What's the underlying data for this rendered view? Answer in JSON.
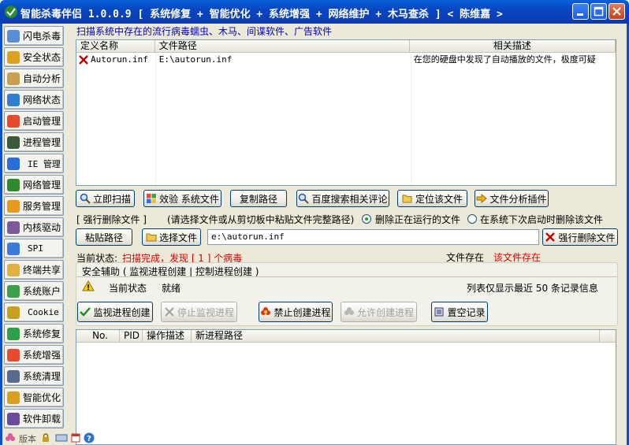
{
  "window": {
    "title": "智能杀毒伴侣 1.0.0.9 [ 系统修复 + 智能优化 + 系统增强 + 网络维护 + 木马查杀 ] < 陈维嘉 >"
  },
  "sidebar": {
    "items": [
      {
        "label": "闪电杀毒",
        "icon": "magnifier-icon"
      },
      {
        "label": "安全状态",
        "icon": "shield-icon"
      },
      {
        "label": "自动分析",
        "icon": "document-icon"
      },
      {
        "label": "网络状态",
        "icon": "globe-icon"
      },
      {
        "label": "启动管理",
        "icon": "windows-icon"
      },
      {
        "label": "进程管理",
        "icon": "terminal-icon"
      },
      {
        "label": "IE 管理",
        "icon": "ie-icon"
      },
      {
        "label": "网络管理",
        "icon": "network-globe-icon"
      },
      {
        "label": "服务管理",
        "icon": "gear-icon"
      },
      {
        "label": "内核驱动",
        "icon": "chip-icon"
      },
      {
        "label": "SPI",
        "icon": "network-icon"
      },
      {
        "label": "终端共享",
        "icon": "folder-share-icon"
      },
      {
        "label": "系统账户",
        "icon": "users-icon"
      },
      {
        "label": "Cookie",
        "icon": "lock-icon"
      },
      {
        "label": "系统修复",
        "icon": "repair-icon"
      },
      {
        "label": "系统增强",
        "icon": "windows-plus-icon"
      },
      {
        "label": "系统清理",
        "icon": "broom-icon"
      },
      {
        "label": "智能优化",
        "icon": "wrench-icon"
      },
      {
        "label": "软件卸载",
        "icon": "uninstall-icon"
      }
    ]
  },
  "scan_hint": "扫描系统中存在的流行病毒蠕虫、木马、间谍软件、广告软件",
  "result_table": {
    "columns": [
      "定义名称",
      "文件路径",
      "相关描述"
    ],
    "rows": [
      {
        "name": "Autorun.inf",
        "path": "E:\\autorun.inf",
        "desc": "在您的硬盘中发现了自动播放的文件，极度可疑"
      }
    ]
  },
  "actions": {
    "scan": "立即扫描",
    "verify": "效验 系统文件",
    "copy_path": "复制路径",
    "baidu": "百度搜索相关评论",
    "locate": "定位该文件",
    "analyze": "文件分析插件"
  },
  "force_delete": {
    "title": "[ 强行删除文件 ]",
    "hint": "(请选择文件或从剪切板中粘贴文件完整路径)",
    "radio1": "删除正在运行的文件",
    "radio2": "在系统下次启动时删除该文件",
    "paste_path": "粘贴路径",
    "choose_file": "选择文件",
    "path_value": "e:\\autorun.inf",
    "force_delete_btn": "强行删除文件"
  },
  "status": {
    "label": "当前状态:",
    "value": "扫描完成，发现 [ 1 ] 个病毒",
    "file_exists_label": "文件存在",
    "file_exists_value": "该文件存在"
  },
  "tabs": {
    "label": "安全辅助 ( 监视进程创建 | 控制进程创建 )"
  },
  "monitor": {
    "state_label": "当前状态",
    "state_value": "就绪",
    "list_note": "列表仅显示最近 50 条记录信息",
    "btn_start": "监视进程创建",
    "btn_stop": "停止监视进程",
    "btn_block": "禁止创建进程",
    "btn_allow": "允许创建进程",
    "btn_clear": "置空记录"
  },
  "process_table": {
    "columns": [
      "No.",
      "PID",
      "操作描述",
      "新进程路径"
    ]
  },
  "statusbar": {
    "version_label": "版本"
  },
  "colors": {
    "title_bar": "#0a46c2",
    "hint_blue": "#0000c0",
    "status_red": "#e00000",
    "client_bg": "#ece9d8"
  }
}
